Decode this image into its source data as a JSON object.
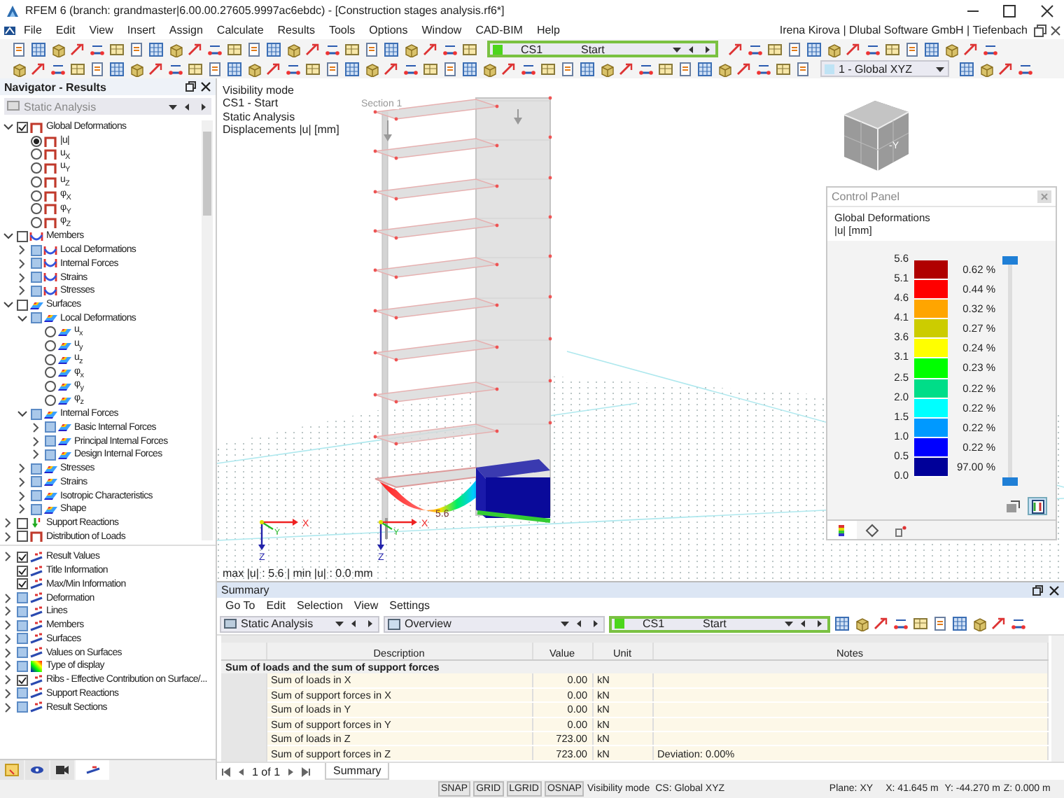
{
  "window": {
    "title": "RFEM 6 (branch: grandmaster|6.00.00.27605.9997ac6ebdc) - [Construction stages analysis.rf6*]"
  },
  "menu": {
    "items": [
      "File",
      "Edit",
      "View",
      "Insert",
      "Assign",
      "Calculate",
      "Results",
      "Tools",
      "Options",
      "Window",
      "CAD-BIM",
      "Help"
    ],
    "user": "Irena Kirova | Dlubal Software GmbH | Tiefenbach"
  },
  "toolbar": {
    "load_case": {
      "code": "CS1",
      "name": "Start",
      "color": "#4cd61c"
    },
    "view": "1 - Global XYZ"
  },
  "navigator": {
    "title": "Navigator - Results",
    "selector": "Static Analysis",
    "results_tree": [
      {
        "label": "Global Deformations",
        "kind": "checkbox",
        "checked": true,
        "expanded": true,
        "children": [
          {
            "label": "|u|",
            "kind": "radio",
            "selected": true
          },
          {
            "label": "u$_{X}$",
            "kind": "radio",
            "selected": false
          },
          {
            "label": "u$_{Y}$",
            "kind": "radio",
            "selected": false
          },
          {
            "label": "u$_{Z}$",
            "kind": "radio",
            "selected": false
          },
          {
            "label": "φ$_{X}$",
            "kind": "radio",
            "selected": false
          },
          {
            "label": "φ$_{Y}$",
            "kind": "radio",
            "selected": false
          },
          {
            "label": "φ$_{Z}$",
            "kind": "radio",
            "selected": false
          }
        ]
      },
      {
        "label": "Members",
        "kind": "checkbox",
        "checked": false,
        "expanded": true,
        "children": [
          {
            "label": "Local Deformations",
            "kind": "checkbox",
            "checked": false,
            "partial": true,
            "expanded": false
          },
          {
            "label": "Internal Forces",
            "kind": "checkbox",
            "checked": false,
            "partial": true,
            "expanded": false
          },
          {
            "label": "Strains",
            "kind": "checkbox",
            "checked": false,
            "partial": true,
            "expanded": false
          },
          {
            "label": "Stresses",
            "kind": "checkbox",
            "checked": false,
            "partial": true,
            "expanded": false
          }
        ]
      },
      {
        "label": "Surfaces",
        "kind": "checkbox",
        "checked": false,
        "expanded": true,
        "children": [
          {
            "label": "Local Deformations",
            "kind": "checkbox",
            "checked": false,
            "partial": true,
            "expanded": true,
            "children": [
              {
                "label": "u$_{x}$",
                "kind": "radio",
                "selected": false
              },
              {
                "label": "u$_{y}$",
                "kind": "radio",
                "selected": false
              },
              {
                "label": "u$_{z}$",
                "kind": "radio",
                "selected": false
              },
              {
                "label": "φ$_{x}$",
                "kind": "radio",
                "selected": false
              },
              {
                "label": "φ$_{y}$",
                "kind": "radio",
                "selected": false
              },
              {
                "label": "φ$_{z}$",
                "kind": "radio",
                "selected": false
              }
            ]
          },
          {
            "label": "Internal Forces",
            "kind": "checkbox",
            "checked": false,
            "partial": true,
            "expanded": true,
            "children": [
              {
                "label": "Basic Internal Forces",
                "kind": "checkbox",
                "checked": false,
                "partial": true,
                "expanded": false
              },
              {
                "label": "Principal Internal Forces",
                "kind": "checkbox",
                "checked": false,
                "partial": true,
                "expanded": false
              },
              {
                "label": "Design Internal Forces",
                "kind": "checkbox",
                "checked": false,
                "partial": true,
                "expanded": false
              }
            ]
          },
          {
            "label": "Stresses",
            "kind": "checkbox",
            "checked": false,
            "partial": true,
            "expanded": false
          },
          {
            "label": "Strains",
            "kind": "checkbox",
            "checked": false,
            "partial": true,
            "expanded": false
          },
          {
            "label": "Isotropic Characteristics",
            "kind": "checkbox",
            "checked": false,
            "partial": true,
            "expanded": false
          },
          {
            "label": "Shape",
            "kind": "checkbox",
            "checked": false,
            "partial": true,
            "expanded": false
          }
        ]
      },
      {
        "label": "Support Reactions",
        "kind": "checkbox",
        "checked": false,
        "expanded": false
      },
      {
        "label": "Distribution of Loads",
        "kind": "checkbox",
        "checked": false,
        "expanded": false
      }
    ],
    "display_tree": [
      {
        "label": "Result Values",
        "kind": "checkbox",
        "checked": true,
        "expanded": false
      },
      {
        "label": "Title Information",
        "kind": "checkbox",
        "checked": true
      },
      {
        "label": "Max/Min Information",
        "kind": "checkbox",
        "checked": true
      },
      {
        "label": "Deformation",
        "kind": "checkbox",
        "checked": false,
        "partial": true,
        "expanded": false
      },
      {
        "label": "Lines",
        "kind": "checkbox",
        "checked": false,
        "partial": true,
        "expanded": false
      },
      {
        "label": "Members",
        "kind": "checkbox",
        "checked": false,
        "partial": true,
        "expanded": false
      },
      {
        "label": "Surfaces",
        "kind": "checkbox",
        "checked": false,
        "partial": true,
        "expanded": false
      },
      {
        "label": "Values on Surfaces",
        "kind": "checkbox",
        "checked": false,
        "partial": true,
        "expanded": false
      },
      {
        "label": "Type of display",
        "kind": "checkbox",
        "checked": false,
        "partial": true,
        "expanded": false
      },
      {
        "label": "Ribs - Effective Contribution on Surface/...",
        "kind": "checkbox",
        "checked": true,
        "expanded": false
      },
      {
        "label": "Support Reactions",
        "kind": "checkbox",
        "checked": false,
        "partial": true,
        "expanded": false
      },
      {
        "label": "Result Sections",
        "kind": "checkbox",
        "checked": false,
        "partial": true,
        "expanded": false
      }
    ],
    "tabs": [
      {
        "selected": false
      },
      {
        "selected": false
      },
      {
        "selected": false
      },
      {
        "selected": true
      }
    ]
  },
  "viewport": {
    "info_lines": [
      "Visibility mode",
      "CS1 - Start",
      "Static Analysis",
      "Displacements |u| [mm]"
    ],
    "section_label": "Section 1",
    "max_value_label": "5.6",
    "axes": [
      {
        "x": "X",
        "y": "Y",
        "z": "Z"
      },
      {
        "x": "X",
        "y": "Y",
        "z": "Z"
      }
    ],
    "view_cube": "-Y",
    "footer": "max |u| : 5.6 | min |u| : 0.0 mm"
  },
  "control_panel": {
    "title": "Control Panel",
    "heading": "Global Deformations",
    "unit": "|u| [mm]",
    "scale_values": [
      "5.6",
      "5.1",
      "4.6",
      "4.1",
      "3.6",
      "3.1",
      "2.5",
      "2.0",
      "1.5",
      "1.0",
      "0.5",
      "0.0"
    ],
    "bands": [
      {
        "color": "#b00000",
        "percent": "0.62 %"
      },
      {
        "color": "#ff0000",
        "percent": "0.44 %"
      },
      {
        "color": "#ffa500",
        "percent": "0.32 %"
      },
      {
        "color": "#cccc00",
        "percent": "0.27 %"
      },
      {
        "color": "#ffff00",
        "percent": "0.24 %"
      },
      {
        "color": "#00ff00",
        "percent": "0.23 %"
      },
      {
        "color": "#00dd88",
        "percent": "0.22 %"
      },
      {
        "color": "#00ffff",
        "percent": "0.22 %"
      },
      {
        "color": "#0099ff",
        "percent": "0.22 %"
      },
      {
        "color": "#0000ff",
        "percent": "0.22 %"
      },
      {
        "color": "#000099",
        "percent": "97.00 %"
      }
    ],
    "range_thumbs": [
      {
        "level": 1
      },
      {
        "level": 0
      }
    ],
    "tabs": [
      {
        "selected": true
      },
      {
        "selected": false
      },
      {
        "selected": false
      }
    ]
  },
  "summary": {
    "title": "Summary",
    "menu": [
      "Go To",
      "Edit",
      "Selection",
      "View",
      "Settings"
    ],
    "analysis": "Static Analysis",
    "view": "Overview",
    "load_case": {
      "code": "CS1",
      "name": "Start",
      "color": "#4cd61c"
    },
    "columns": [
      "Description",
      "Value",
      "Unit",
      "Notes"
    ],
    "group": "Sum of loads and the sum of support forces",
    "rows": [
      {
        "description": "Sum of loads in X",
        "value": "0.00",
        "unit": "kN"
      },
      {
        "description": "Sum of support forces in X",
        "value": "0.00",
        "unit": "kN"
      },
      {
        "description": "Sum of loads in Y",
        "value": "0.00",
        "unit": "kN"
      },
      {
        "description": "Sum of support forces in Y",
        "value": "0.00",
        "unit": "kN"
      },
      {
        "description": "Sum of loads in Z",
        "value": "723.00",
        "unit": "kN"
      },
      {
        "description": "Sum of support forces in Z",
        "value": "723.00",
        "unit": "kN",
        "notes": "Deviation: 0.00%"
      }
    ],
    "pager": "1 of 1",
    "tab": "Summary"
  },
  "status_bar": {
    "toggles": [
      "SNAP",
      "GRID",
      "LGRID",
      "OSNAP"
    ],
    "mode": "Visibility mode",
    "cs": "CS: Global XYZ",
    "plane": "Plane: XY",
    "x": "X: 41.645 m",
    "y": "Y: -44.270 m",
    "z": "Z: 0.000 m"
  }
}
